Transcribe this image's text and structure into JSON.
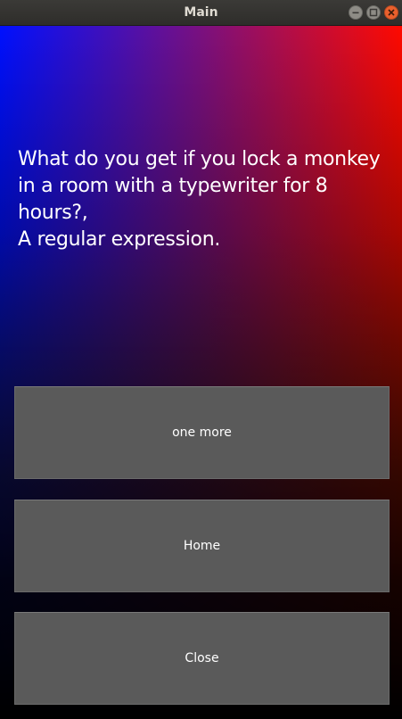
{
  "window": {
    "title": "Main",
    "controls": {
      "minimize_icon": "minimize-icon",
      "maximize_icon": "maximize-icon",
      "close_icon": "close-icon"
    }
  },
  "main": {
    "joke_text": "What do you get if you lock a monkey\nin a room with a typewriter for 8\nhours?,\n A regular expression.",
    "buttons": {
      "one_more": "one more",
      "home": "Home",
      "close": "Close"
    }
  },
  "colors": {
    "gradient_left": "#0010ff",
    "gradient_right": "#ff0a00",
    "gradient_bottom": "#000000",
    "button_bg": "#5a5a5a",
    "text": "#ffffff"
  }
}
